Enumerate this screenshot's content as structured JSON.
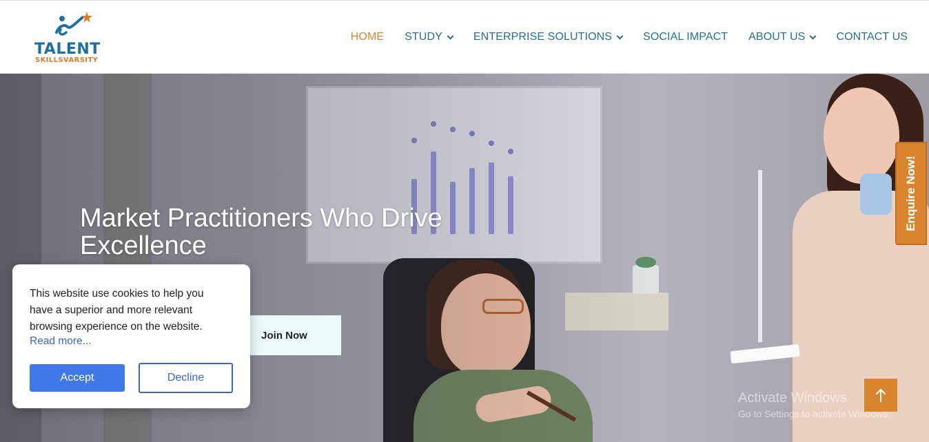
{
  "brand": {
    "name": "TALENT",
    "tagline": "SKILLSVARSITY",
    "primary_color": "#1d6fa5",
    "accent_color": "#d9852f"
  },
  "nav": {
    "items": [
      {
        "label": "HOME",
        "active": true,
        "dropdown": false
      },
      {
        "label": "STUDY",
        "active": false,
        "dropdown": true
      },
      {
        "label": "ENTERPRISE SOLUTIONS",
        "active": false,
        "dropdown": true
      },
      {
        "label": "SOCIAL IMPACT",
        "active": false,
        "dropdown": false
      },
      {
        "label": "ABOUT US",
        "active": false,
        "dropdown": true
      },
      {
        "label": "CONTACT US",
        "active": false,
        "dropdown": false
      }
    ]
  },
  "hero": {
    "title": "Market Practitioners Who Drive Excellence",
    "cta_label": "Join Now"
  },
  "side_tab": {
    "label": "Enquire Now!"
  },
  "scroll_top": {
    "icon": "arrow-up-icon"
  },
  "watermark": {
    "line1": "Activate Windows",
    "line2": "Go to Settings to activate Windows."
  },
  "cookie": {
    "message": "This website use cookies to help you have a superior and more relevant browsing experience on the website.",
    "read_more": "Read more...",
    "accept_label": "Accept",
    "decline_label": "Decline"
  }
}
